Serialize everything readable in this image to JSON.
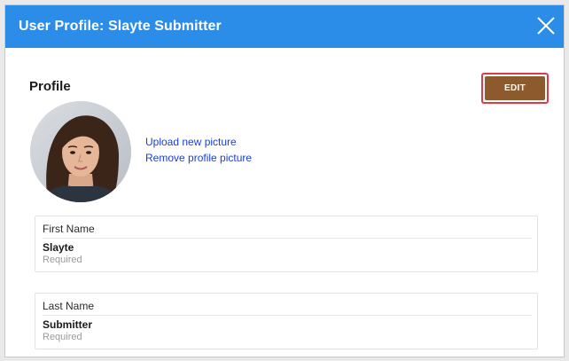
{
  "modal": {
    "title": "User Profile: Slayte Submitter",
    "close_icon": "close-icon"
  },
  "profile": {
    "section_title": "Profile",
    "edit_label": "EDIT",
    "upload_link": "Upload new picture",
    "remove_link": "Remove profile picture"
  },
  "fields": [
    {
      "label": "First Name",
      "value": "Slayte",
      "hint": "Required"
    },
    {
      "label": "Last Name",
      "value": "Submitter",
      "hint": "Required"
    }
  ],
  "colors": {
    "header": "#2b8de8",
    "edit_button": "#8c5a2c",
    "highlight": "#e0394a",
    "link": "#1a3fd6"
  }
}
